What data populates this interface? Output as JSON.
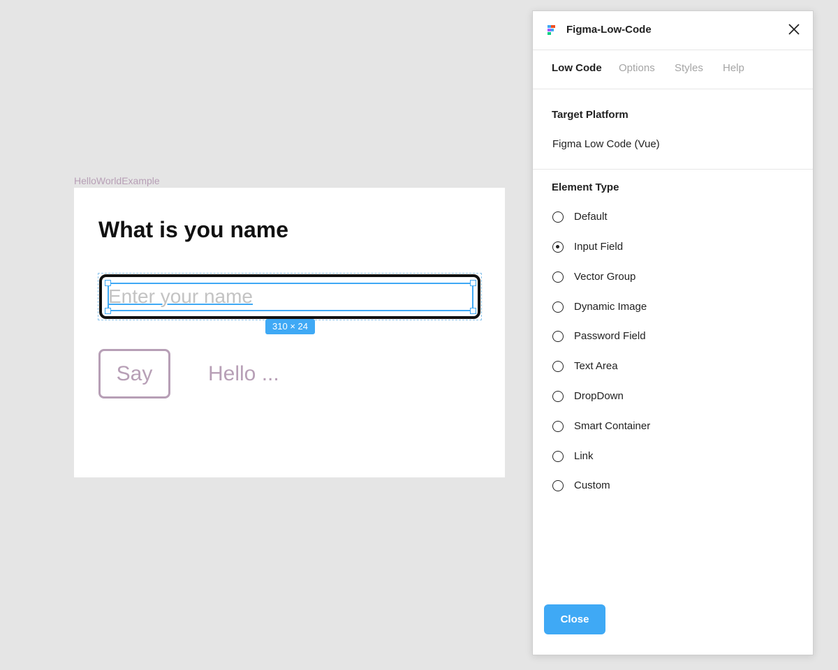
{
  "canvas": {
    "frame_label": "HelloWorldExample",
    "heading": "What is you name",
    "input_placeholder": "Enter your name",
    "selection_size": "310 × 24",
    "say_button": "Say",
    "hello_text": "Hello ..."
  },
  "plugin": {
    "title": "Figma-Low-Code",
    "tabs": [
      {
        "label": "Low Code",
        "active": true
      },
      {
        "label": "Options",
        "active": false
      },
      {
        "label": "Styles",
        "active": false
      },
      {
        "label": "Help",
        "active": false
      }
    ],
    "target_platform": {
      "title": "Target Platform",
      "value": "Figma Low Code (Vue)"
    },
    "element_type": {
      "title": "Element Type",
      "selected": "Input Field",
      "options": [
        "Default",
        "Input Field",
        "Vector Group",
        "Dynamic Image",
        "Password Field",
        "Text Area",
        "DropDown",
        "Smart Container",
        "Link",
        "Custom"
      ]
    },
    "close_button": "Close"
  },
  "colors": {
    "accent": "#3fa9f5",
    "muted_purple": "#b79fb6",
    "canvas_bg": "#e5e5e5"
  },
  "icons": {
    "plugin_logo": "figma-low-code-logo-icon",
    "close": "close-icon",
    "radio": "radio-icon"
  }
}
